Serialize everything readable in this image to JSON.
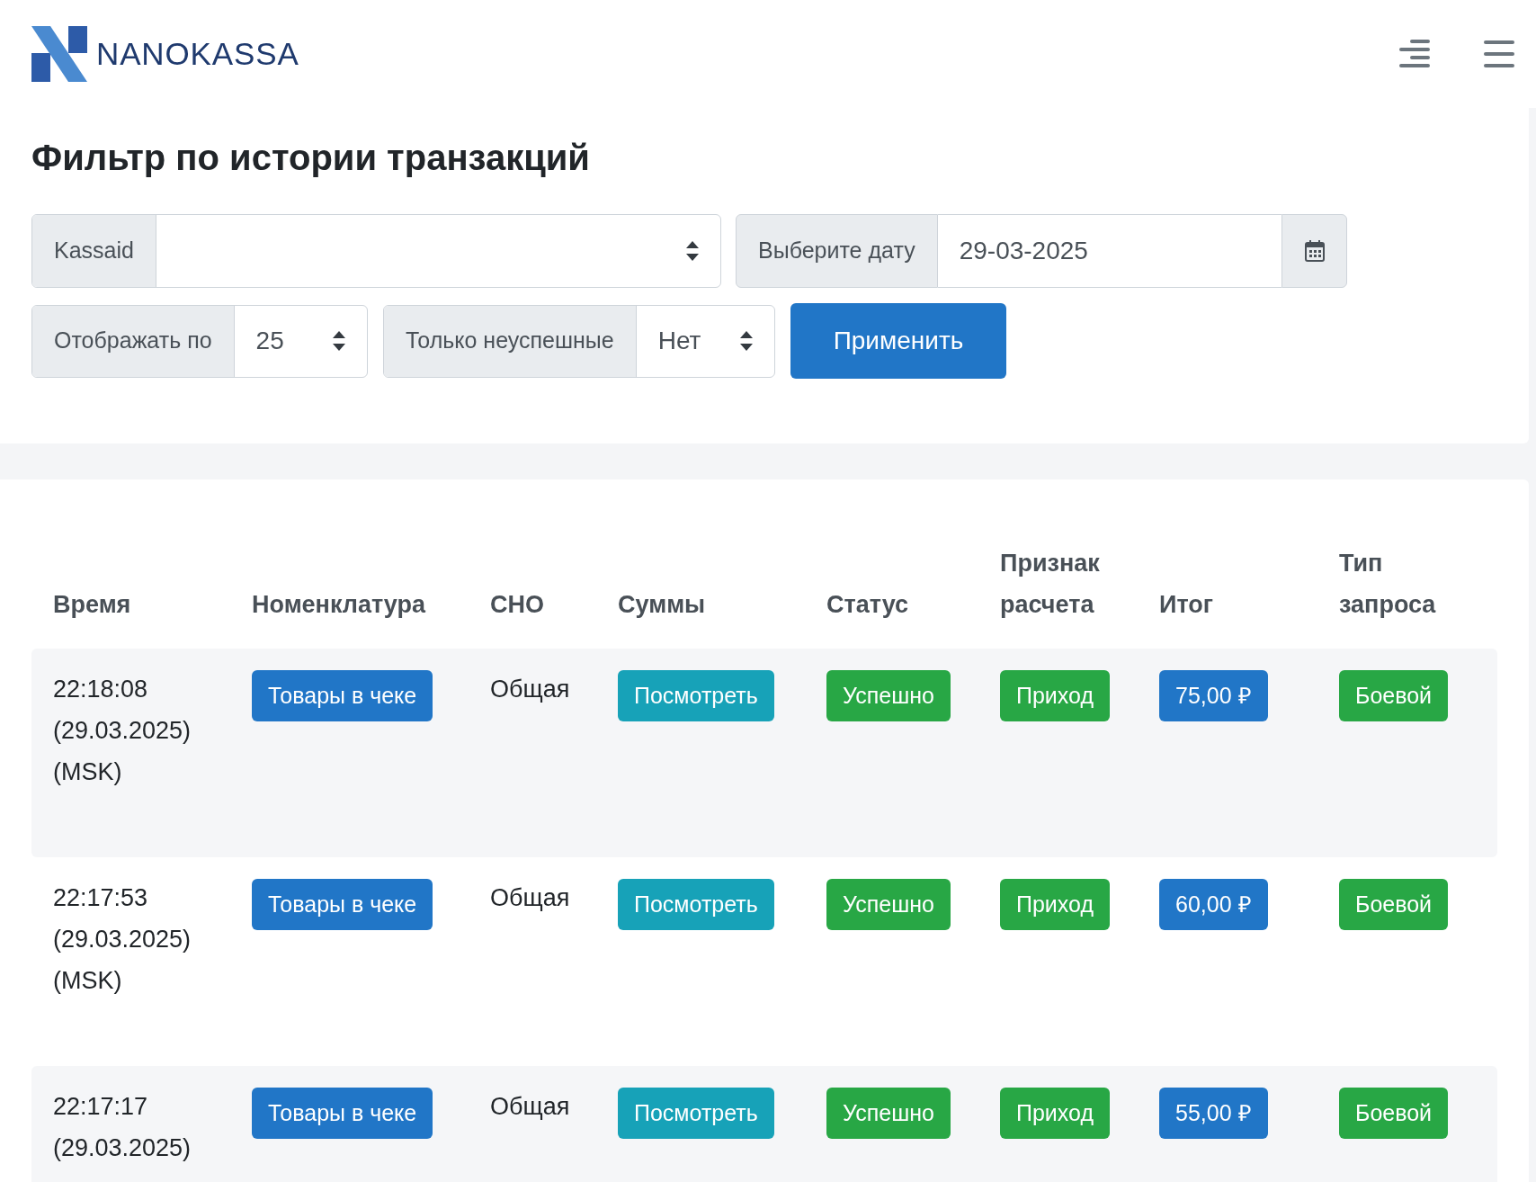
{
  "brand": "NANOKASSA",
  "title": "Фильтр по истории транзакций",
  "filters": {
    "kassaid": {
      "label": "Kassaid"
    },
    "date": {
      "label": "Выберите дату",
      "value": "29-03-2025"
    },
    "per_page": {
      "label": "Отображать по",
      "value": "25"
    },
    "only_failed": {
      "label": "Только неуспешные",
      "value": "Нет"
    },
    "apply": "Применить"
  },
  "table": {
    "columns": [
      "Время",
      "Номенклатура",
      "СНО",
      "Суммы",
      "Статус",
      "Признак расчета",
      "Итог",
      "Тип запроса"
    ],
    "rows": [
      {
        "time": [
          "22:18:08",
          "(29.03.2025)",
          "(MSK)"
        ],
        "items": "Товары в чеке",
        "sno": "Общая",
        "sums": "Посмотреть",
        "status": "Успешно",
        "sign": "Приход",
        "total": "75,00 ₽",
        "type": "Боевой"
      },
      {
        "time": [
          "22:17:53",
          "(29.03.2025)",
          "(MSK)"
        ],
        "items": "Товары в чеке",
        "sno": "Общая",
        "sums": "Посмотреть",
        "status": "Успешно",
        "sign": "Приход",
        "total": "60,00 ₽",
        "type": "Боевой"
      },
      {
        "time": [
          "22:17:17",
          "(29.03.2025)"
        ],
        "items": "Товары в чеке",
        "sno": "Общая",
        "sums": "Посмотреть",
        "status": "Успешно",
        "sign": "Приход",
        "total": "55,00 ₽",
        "type": "Боевой"
      }
    ]
  }
}
